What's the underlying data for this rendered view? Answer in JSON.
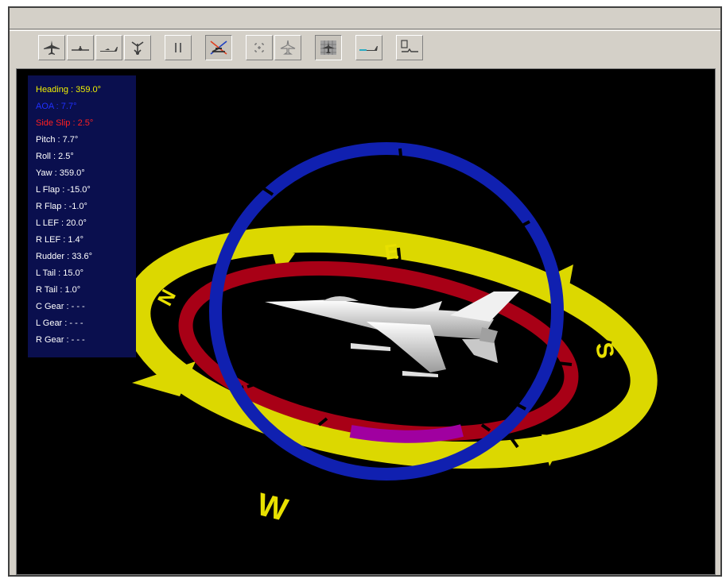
{
  "colors": {
    "viewport_bg": "#000000",
    "hud_bg": "#0a0f4e",
    "heading_text": "#f0f000",
    "aoa_text": "#2030ff",
    "sideslip_text": "#ff2020",
    "readout_text": "#ffffff",
    "compass_yellow": "#e0dc00",
    "ring_red": "#b00018",
    "ring_blue": "#1020b0",
    "overlap_magenta": "#a000a0"
  },
  "toolbar": {
    "buttons": [
      {
        "icon": "aircraft-top-view-icon"
      },
      {
        "icon": "aircraft-front-view-icon"
      },
      {
        "icon": "aircraft-side-view-icon"
      },
      {
        "icon": "aircraft-rear-view-icon"
      },
      {
        "icon": "pause-icon"
      },
      {
        "icon": "axes-view-icon",
        "pressed": true
      },
      {
        "icon": "target-icon"
      },
      {
        "icon": "aircraft-outline-icon"
      },
      {
        "icon": "grid-view-icon",
        "pressed": true
      },
      {
        "icon": "flight-path-icon"
      },
      {
        "icon": "data-plot-icon"
      }
    ]
  },
  "hud": {
    "heading": "Heading : 359.0°",
    "aoa": "AOA : 7.7°",
    "side_slip": "Side Slip : 2.5°",
    "pitch": "Pitch : 7.7°",
    "roll": "Roll : 2.5°",
    "yaw": "Yaw : 359.0°",
    "l_flap": "L Flap : -15.0°",
    "r_flap": "R Flap : -1.0°",
    "l_lef": "L LEF : 20.0°",
    "r_lef": "R LEF : 1.4°",
    "rudder": "Rudder : 33.6°",
    "l_tail": "L Tail : 15.0°",
    "r_tail": "R Tail : 1.0°",
    "c_gear": "C Gear :   - - -",
    "l_gear": "L Gear :   - - -",
    "r_gear": "R Gear :   - - -"
  },
  "compass": {
    "north": "N",
    "east": "E",
    "south": "S",
    "west": "W"
  }
}
